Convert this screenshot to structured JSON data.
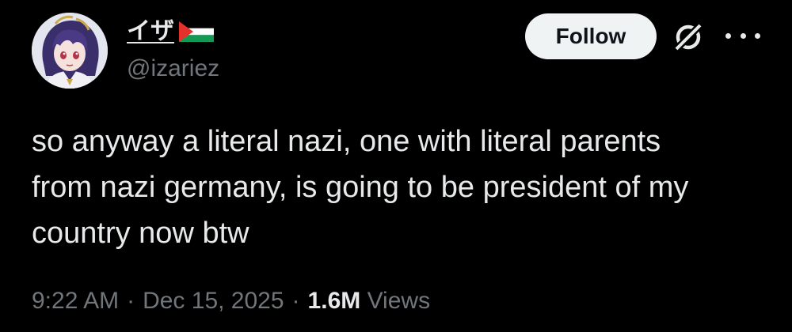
{
  "author": {
    "display_name": "イザ",
    "flag_icon": "palestine-flag-icon",
    "handle": "@izariez",
    "avatar_icon": "anime-character-avatar"
  },
  "actions": {
    "follow_label": "Follow",
    "grok_icon": "grok-icon",
    "more_icon": "more-options-icon"
  },
  "tweet": {
    "text": "so anyway a literal nazi, one with literal parents\nfrom nazi germany, is going to be president of my\ncountry now btw"
  },
  "meta": {
    "time": "9:22 AM",
    "separator1": "·",
    "date": "Dec 15, 2025",
    "separator2": "·",
    "views_count": "1.6M",
    "views_label": "Views"
  },
  "colors": {
    "background": "#000000",
    "text_primary": "#e7e9ea",
    "text_secondary": "#71767b",
    "follow_bg": "#eff3f4",
    "follow_text": "#0f1419"
  }
}
